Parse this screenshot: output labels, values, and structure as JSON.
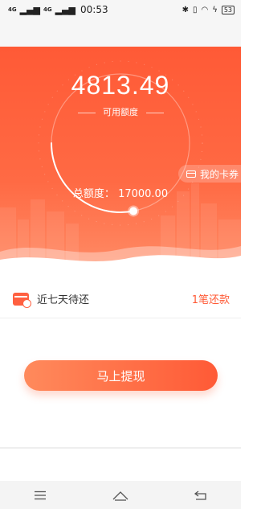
{
  "status_bar": {
    "signal_1": "4G",
    "signal_2": "4G",
    "time": "00:53",
    "battery": "53"
  },
  "hero": {
    "available_amount": "4813.49",
    "available_label": "可用额度",
    "total_limit_label": "总额度：",
    "total_limit_value": "17000.00",
    "usage_fraction": 0.28,
    "my_coupons_label": "我的卡券"
  },
  "repayment": {
    "label": "近七天待还",
    "count_text": "1笔还款"
  },
  "actions": {
    "withdraw_label": "马上提现"
  },
  "colors": {
    "accent": "#ff5a36",
    "hero_top": "#ff5a36",
    "hero_bottom": "#ff8c66"
  },
  "nav": {
    "icons": [
      "menu-icon",
      "home-icon",
      "back-icon"
    ]
  }
}
